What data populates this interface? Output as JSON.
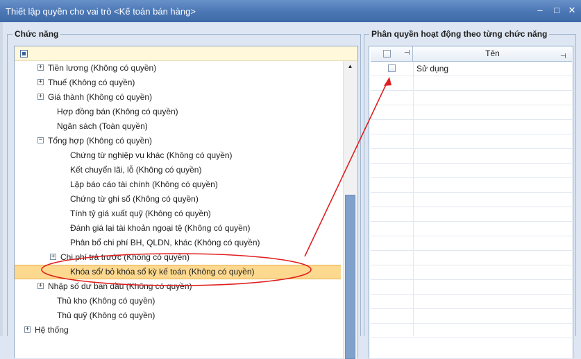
{
  "window": {
    "title": "Thiết lập quyền cho vai trò <Kế toán bán hàng>",
    "minimize_glyph": "–",
    "maximize_glyph": "□",
    "close_glyph": "✕"
  },
  "left_group": {
    "title": "Chức năng",
    "tree_rows": [
      {
        "label": "Tiền lương (Không có quyền)",
        "expander": "+"
      },
      {
        "label": "Thuế (Không có quyền)",
        "expander": "+"
      },
      {
        "label": "Giá thành (Không có quyền)",
        "expander": "+"
      },
      {
        "label": "Hợp đồng bán (Không có quyền)",
        "expander": ""
      },
      {
        "label": "Ngân sách (Toàn quyền)",
        "expander": ""
      },
      {
        "label": "Tổng hợp (Không có quyền)",
        "expander": "−"
      },
      {
        "label": "Chứng từ nghiệp vụ khác (Không có quyền)",
        "expander": ""
      },
      {
        "label": "Kết chuyển lãi, lỗ (Không có quyền)",
        "expander": ""
      },
      {
        "label": "Lập báo cáo tài chính (Không có quyền)",
        "expander": ""
      },
      {
        "label": "Chứng từ ghi sổ (Không có quyền)",
        "expander": ""
      },
      {
        "label": "Tính tỷ giá xuất quỹ (Không có quyền)",
        "expander": ""
      },
      {
        "label": "Đánh giá lại tài khoản ngoại tệ (Không có quyền)",
        "expander": ""
      },
      {
        "label": "Phân bổ chi phí BH, QLDN, khác (Không có quyền)",
        "expander": ""
      },
      {
        "label": "Chi phí trả trước (Không có quyền)",
        "expander": "+"
      },
      {
        "label": "Khóa sổ/ bỏ khóa sổ kỳ kế toán (Không có quyền)",
        "expander": "",
        "selected": true
      },
      {
        "label": "Nhập số dư ban đầu (Không có quyền)",
        "expander": "+"
      },
      {
        "label": "Thủ kho (Không có quyền)",
        "expander": ""
      },
      {
        "label": "Thủ quỹ (Không có quyền)",
        "expander": ""
      },
      {
        "label": "Hệ thống",
        "expander": "+"
      }
    ],
    "scroll_up_glyph": "▲"
  },
  "right_group": {
    "title": "Phân quyền hoạt động theo từng chức năng",
    "column_name": "Tên",
    "pin_glyph": "⊣",
    "rows": [
      {
        "name": "Sử dụng",
        "checked": false
      }
    ]
  },
  "colors": {
    "titlebar": "#4a76b4",
    "selection": "#fdd98f",
    "annotation": "#e02020"
  }
}
